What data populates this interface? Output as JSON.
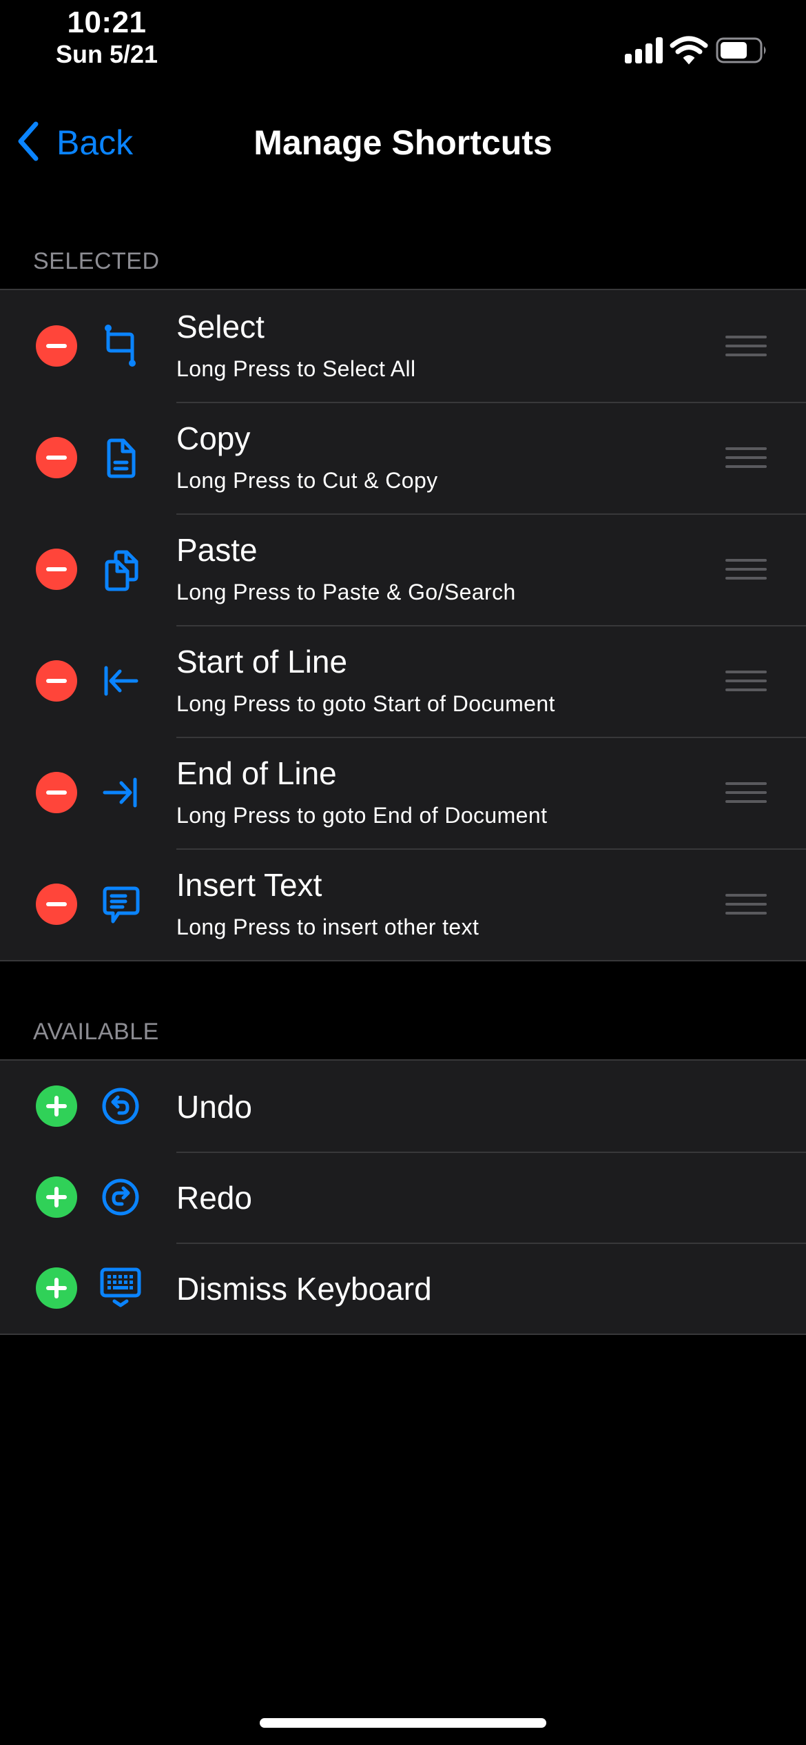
{
  "status_bar": {
    "time": "10:21",
    "date": "Sun 5/21",
    "icons": [
      "cellular-signal-icon",
      "wifi-icon",
      "battery-icon"
    ],
    "battery_level": 0.7
  },
  "nav": {
    "back_label": "Back",
    "title": "Manage Shortcuts"
  },
  "colors": {
    "accent": "#0a84ff",
    "remove": "#ff453a",
    "add": "#30d158",
    "row_bg": "#1c1c1e",
    "separator": "#38383a",
    "section_header": "#8d8d93"
  },
  "selected": {
    "header": "SELECTED",
    "items": [
      {
        "title": "Select",
        "subtitle": "Long Press to Select All",
        "icon": "crop-icon"
      },
      {
        "title": "Copy",
        "subtitle": "Long Press to Cut & Copy",
        "icon": "document-icon"
      },
      {
        "title": "Paste",
        "subtitle": "Long Press to Paste & Go/Search",
        "icon": "documents-icon"
      },
      {
        "title": "Start of Line",
        "subtitle": "Long Press to goto Start of Document",
        "icon": "arrow-left-to-line-icon"
      },
      {
        "title": "End of Line",
        "subtitle": "Long Press to goto End of Document",
        "icon": "arrow-right-to-line-icon"
      },
      {
        "title": "Insert Text",
        "subtitle": "Long Press to insert other text",
        "icon": "text-bubble-icon"
      }
    ]
  },
  "available": {
    "header": "AVAILABLE",
    "items": [
      {
        "title": "Undo",
        "icon": "undo-circle-icon"
      },
      {
        "title": "Redo",
        "icon": "redo-circle-icon"
      },
      {
        "title": "Dismiss Keyboard",
        "icon": "keyboard-dismiss-icon"
      }
    ]
  }
}
